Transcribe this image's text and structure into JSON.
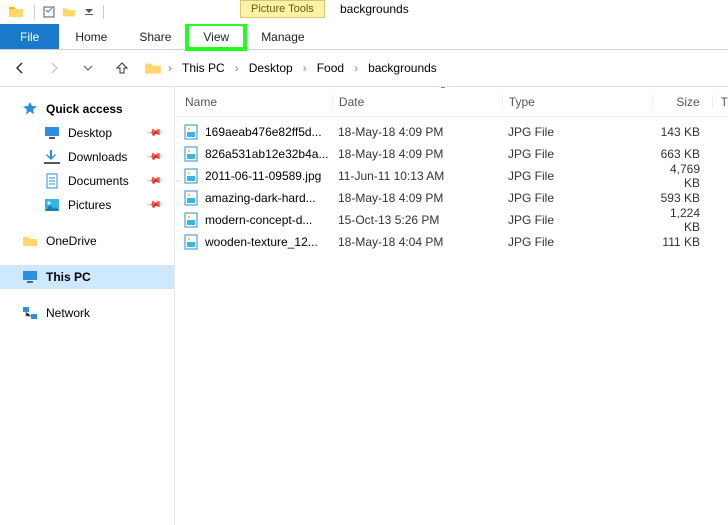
{
  "title": {
    "context_tab": "Picture Tools",
    "window_title": "backgrounds"
  },
  "ribbon": {
    "file": "File",
    "home": "Home",
    "share": "Share",
    "view": "View",
    "manage": "Manage"
  },
  "breadcrumbs": [
    "This PC",
    "Desktop",
    "Food",
    "backgrounds"
  ],
  "nav": {
    "quick_access": "Quick access",
    "desktop": "Desktop",
    "downloads": "Downloads",
    "documents": "Documents",
    "pictures": "Pictures",
    "onedrive": "OneDrive",
    "this_pc": "This PC",
    "network": "Network"
  },
  "columns": {
    "name": "Name",
    "date": "Date",
    "type": "Type",
    "size": "Size",
    "extra": "T"
  },
  "files": [
    {
      "name": "169aeab476e82ff5d...",
      "date": "18-May-18 4:09 PM",
      "type": "JPG File",
      "size": "143 KB"
    },
    {
      "name": "826a531ab12e32b4a...",
      "date": "18-May-18 4:09 PM",
      "type": "JPG File",
      "size": "663 KB"
    },
    {
      "name": "2011-06-11-09589.jpg",
      "date": "11-Jun-11 10:13 AM",
      "type": "JPG File",
      "size": "4,769 KB"
    },
    {
      "name": "amazing-dark-hard...",
      "date": "18-May-18 4:09 PM",
      "type": "JPG File",
      "size": "593 KB"
    },
    {
      "name": "modern-concept-d...",
      "date": "15-Oct-13 5:26 PM",
      "type": "JPG File",
      "size": "1,224 KB"
    },
    {
      "name": "wooden-texture_12...",
      "date": "18-May-18 4:04 PM",
      "type": "JPG File",
      "size": "111 KB"
    }
  ]
}
